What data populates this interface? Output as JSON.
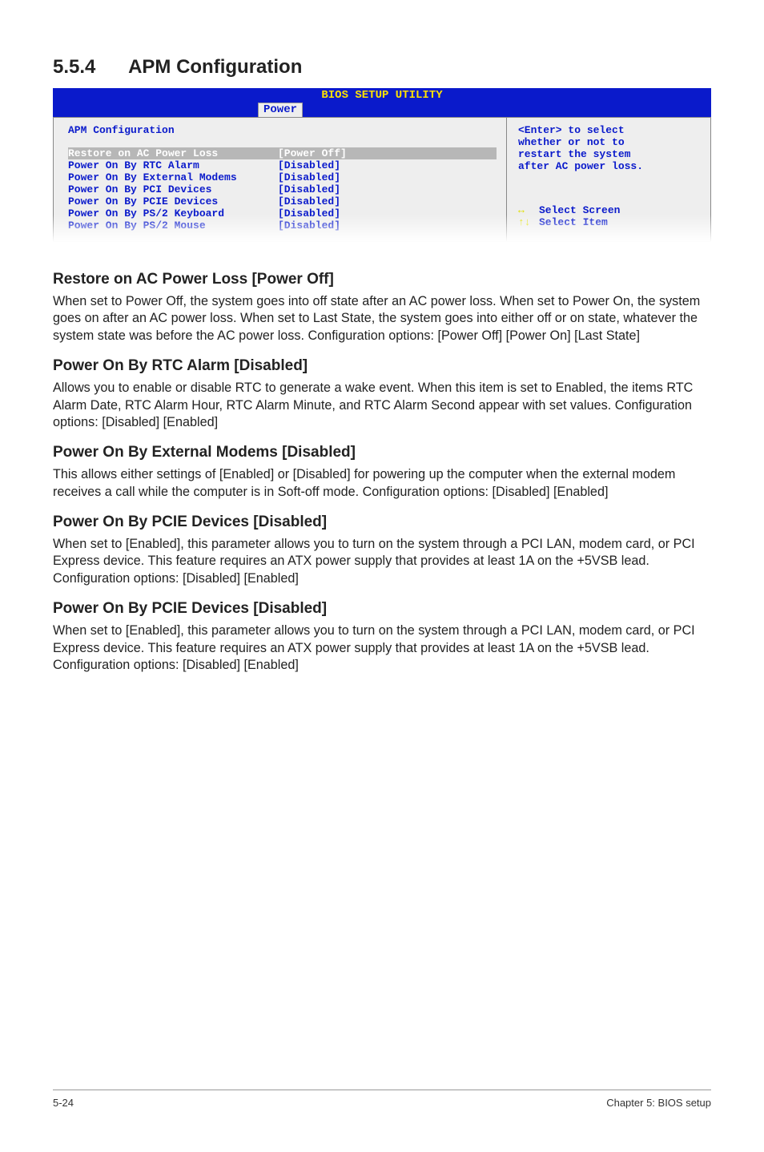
{
  "section": {
    "number": "5.5.4",
    "title": "APM Configuration"
  },
  "bios": {
    "title": "BIOS SETUP UTILITY",
    "tab": "Power",
    "panel_heading": "APM Configuration",
    "rows": [
      {
        "label": "Restore on AC Power Loss",
        "value": "[Power Off]",
        "selected": true
      },
      {
        "label": "Power On By RTC Alarm",
        "value": "[Disabled]"
      },
      {
        "label": "Power On By External Modems",
        "value": "[Disabled]"
      },
      {
        "label": "Power On By PCI Devices",
        "value": "[Disabled]"
      },
      {
        "label": "Power On By PCIE Devices",
        "value": "[Disabled]"
      },
      {
        "label": "Power On By PS/2 Keyboard",
        "value": "[Disabled]"
      },
      {
        "label": "Power On By PS/2 Mouse",
        "value": "[Disabled]"
      }
    ],
    "help": {
      "line1": "<Enter> to select",
      "line2": "whether or not to",
      "line3": "restart the system",
      "line4": "after AC power loss."
    },
    "nav": {
      "arrow_lr": "↔",
      "select_screen": "Select Screen",
      "arrow_ud": "↑↓",
      "select_item": "Select Item"
    }
  },
  "doc": {
    "h1": "Restore on AC Power Loss [Power Off]",
    "p1": "When set to Power Off, the system goes into off state after an AC power loss. When set to Power On, the system goes on after an AC power loss. When set to Last State, the system goes into either off or on state, whatever the system state was before the AC power loss. Configuration options: [Power Off] [Power On] [Last State]",
    "h2": "Power On By RTC Alarm [Disabled]",
    "p2": "Allows you to enable or disable RTC to generate a wake event. When this item is set to Enabled, the items RTC Alarm Date, RTC Alarm Hour, RTC Alarm Minute, and RTC Alarm Second appear with set values. Configuration options: [Disabled] [Enabled]",
    "h3": "Power On By External Modems [Disabled]",
    "p3": "This allows either settings of [Enabled] or [Disabled] for powering up the computer when the external modem receives a call while the computer is in Soft-off mode. Configuration options: [Disabled] [Enabled]",
    "h4": "Power On By PCIE Devices [Disabled]",
    "p4": "When set to [Enabled], this parameter allows you to turn on the system through a PCI LAN, modem card, or PCI Express device. This feature requires an ATX power supply that provides at least 1A on the +5VSB lead.\nConfiguration options: [Disabled] [Enabled]",
    "h5": "Power On By PCIE Devices [Disabled]",
    "p5": "When set to [Enabled], this parameter allows you to turn on the system through a PCI LAN, modem card, or PCI Express device. This feature requires an ATX power supply that provides at least 1A on the +5VSB lead.\nConfiguration options: [Disabled] [Enabled]"
  },
  "footer": {
    "left": "5-24",
    "right": "Chapter 5: BIOS setup"
  }
}
